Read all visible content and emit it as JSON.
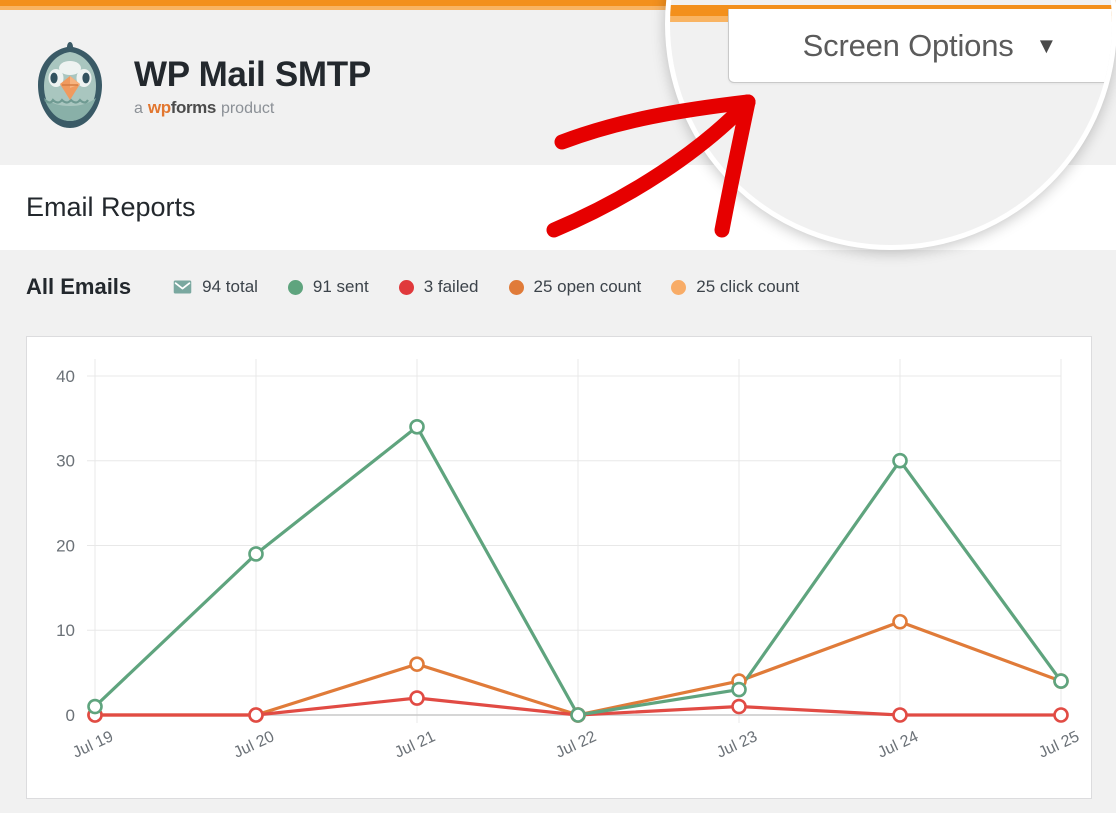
{
  "theme": {
    "accent_orange": "#f3901d",
    "accent_orange_light": "#f9b463",
    "sent_green": "#5fa47e",
    "failed_red": "#e14b44",
    "open_orange": "#e07b39",
    "click_orange": "#f8ac67",
    "envelope_teal": "#7aa8a0",
    "page_bg": "#f1f1f1",
    "card_bg": "#ffffff",
    "text_dark": "#23282d",
    "annotation_red": "#e60000"
  },
  "brand": {
    "logo_icon": "pigeon-mascot-logo",
    "title": "WP Mail SMTP",
    "subtitle_prefix": "a",
    "subtitle_brand_wp": "wp",
    "subtitle_brand_forms": "forms",
    "subtitle_suffix": "product"
  },
  "screen_options": {
    "label": "Screen Options",
    "caret_icon": "chevron-down-icon",
    "caret_glyph": "▼"
  },
  "annotation": {
    "arrow_icon": "red-arrow-annotation",
    "lens_icon": "magnifier-lens-overlay"
  },
  "page": {
    "title": "Email Reports"
  },
  "report": {
    "section_title": "All Emails",
    "legend": [
      {
        "icon": "envelope-icon",
        "color": "#7aa8a0",
        "value": "94",
        "label": "total",
        "text": "94 total"
      },
      {
        "icon": "dot-icon",
        "color": "#5fa47e",
        "value": "91",
        "label": "sent",
        "text": "91 sent"
      },
      {
        "icon": "dot-icon",
        "color": "#e14b44",
        "value": "3",
        "label": "failed",
        "text": "3 failed"
      },
      {
        "icon": "dot-icon",
        "color": "#e07b39",
        "value": "25",
        "label": "open count",
        "text": "25 open count"
      },
      {
        "icon": "dot-icon",
        "color": "#f8ac67",
        "value": "25",
        "label": "click count",
        "text": "25 click count"
      }
    ]
  },
  "chart_data": {
    "type": "line",
    "title": "All Emails",
    "xlabel": "",
    "ylabel": "",
    "x": [
      "Jul 19",
      "Jul 20",
      "Jul 21",
      "Jul 22",
      "Jul 23",
      "Jul 24",
      "Jul 25"
    ],
    "categories": [
      "Jul 19",
      "Jul 20",
      "Jul 21",
      "Jul 22",
      "Jul 23",
      "Jul 24",
      "Jul 25"
    ],
    "yticks": [
      0,
      10,
      20,
      30,
      40
    ],
    "ylim": [
      0,
      42
    ],
    "grid": true,
    "legend_position": "top-right",
    "xtick_rotation": -25,
    "series": [
      {
        "name": "sent",
        "color": "#5fa47e",
        "values": [
          1,
          19,
          34,
          0,
          3,
          30,
          4
        ]
      },
      {
        "name": "failed",
        "color": "#e14b44",
        "values": [
          0,
          0,
          2,
          0,
          1,
          0,
          0
        ]
      },
      {
        "name": "open count",
        "color": "#e07b39",
        "values": [
          0,
          0,
          6,
          0,
          4,
          11,
          4
        ]
      }
    ]
  }
}
